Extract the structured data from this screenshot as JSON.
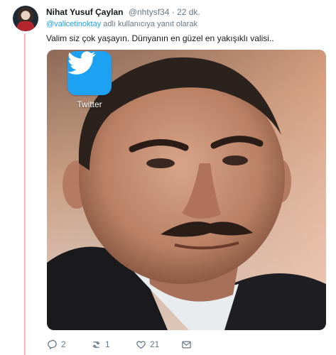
{
  "tweet": {
    "author_name": "Nihat Yusuf Çaylan",
    "handle": "@nhtysf34",
    "separator": "·",
    "time": "22 dk.",
    "reply_mention": "@valicetinoktay",
    "reply_suffix": "adlı kullanıcıya yanıt olarak",
    "text": "Valim siz çok yaşayın. Dünyanın en güzel en yakışıklı valisi..",
    "overlay_badge_label": "Twitter",
    "actions": {
      "reply_count": "2",
      "retweet_count": "1",
      "like_count": "21"
    }
  },
  "colors": {
    "accent": "#1da1f2",
    "thread_line": "#ffb3c4",
    "muted_text": "#657786"
  },
  "icons": [
    "reply-icon",
    "retweet-icon",
    "like-icon",
    "direct-message-icon",
    "twitter-bird-icon"
  ]
}
